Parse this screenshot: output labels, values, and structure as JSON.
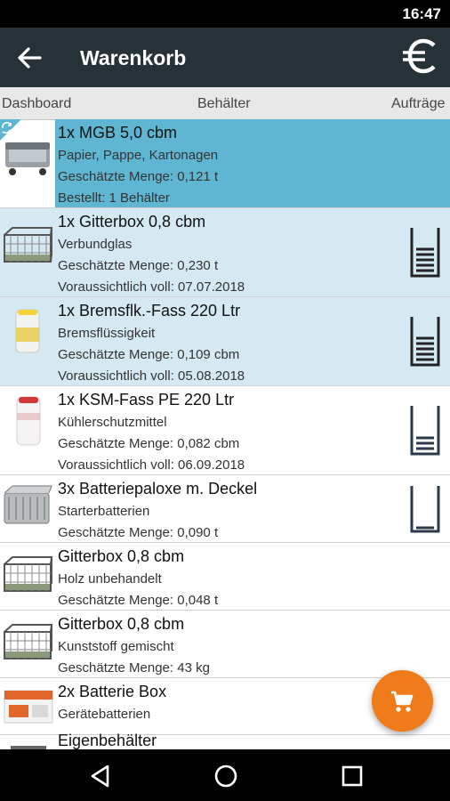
{
  "status_bar": {
    "time": "16:47"
  },
  "app_bar": {
    "title": "Warenkorb",
    "back_icon": "arrow-left-icon",
    "currency_icon": "euro-icon"
  },
  "tabs": {
    "left": "Dashboard",
    "center": "Behälter",
    "right": "Aufträge"
  },
  "items": [
    {
      "title": "1x MGB 5,0 cbm",
      "sub": "Papier, Pappe, Kartonagen",
      "line3": "Geschätzte Menge: 0,121 t",
      "line4": "Bestellt: 1 Behälter"
    },
    {
      "title": "1x Gitterbox 0,8 cbm",
      "sub": "Verbundglas",
      "line3": "Geschätzte Menge: 0,230 t",
      "line4": "Voraussichtlich voll: 07.07.2018"
    },
    {
      "title": "1x Bremsflk.-Fass 220 Ltr",
      "sub": "Bremsflüssigkeit",
      "line3": "Geschätzte Menge: 0,109 cbm",
      "line4": "Voraussichtlich voll: 05.08.2018"
    },
    {
      "title": "1x KSM-Fass PE 220 Ltr",
      "sub": "Kühlerschutzmittel",
      "line3": "Geschätzte Menge: 0,082 cbm",
      "line4": "Voraussichtlich voll: 06.09.2018"
    },
    {
      "title": "3x Batteriepaloxe m. Deckel",
      "sub": "Starterbatterien",
      "line3": "Geschätzte Menge: 0,090 t"
    },
    {
      "title": "Gitterbox 0,8 cbm",
      "sub": "Holz unbehandelt",
      "line3": "Geschätzte Menge: 0,048 t"
    },
    {
      "title": "Gitterbox 0,8 cbm",
      "sub": "Kunststoff gemischt",
      "line3": "Geschätzte Menge: 43 kg"
    },
    {
      "title": "2x Batterie Box",
      "sub": "Gerätebatterien"
    },
    {
      "title": "Eigenbehälter"
    }
  ],
  "colors": {
    "app_bar": "#263238",
    "selected_row": "#5fb6d2",
    "scheduled_row": "#d4e9f1",
    "fab": "#f07b1b"
  }
}
